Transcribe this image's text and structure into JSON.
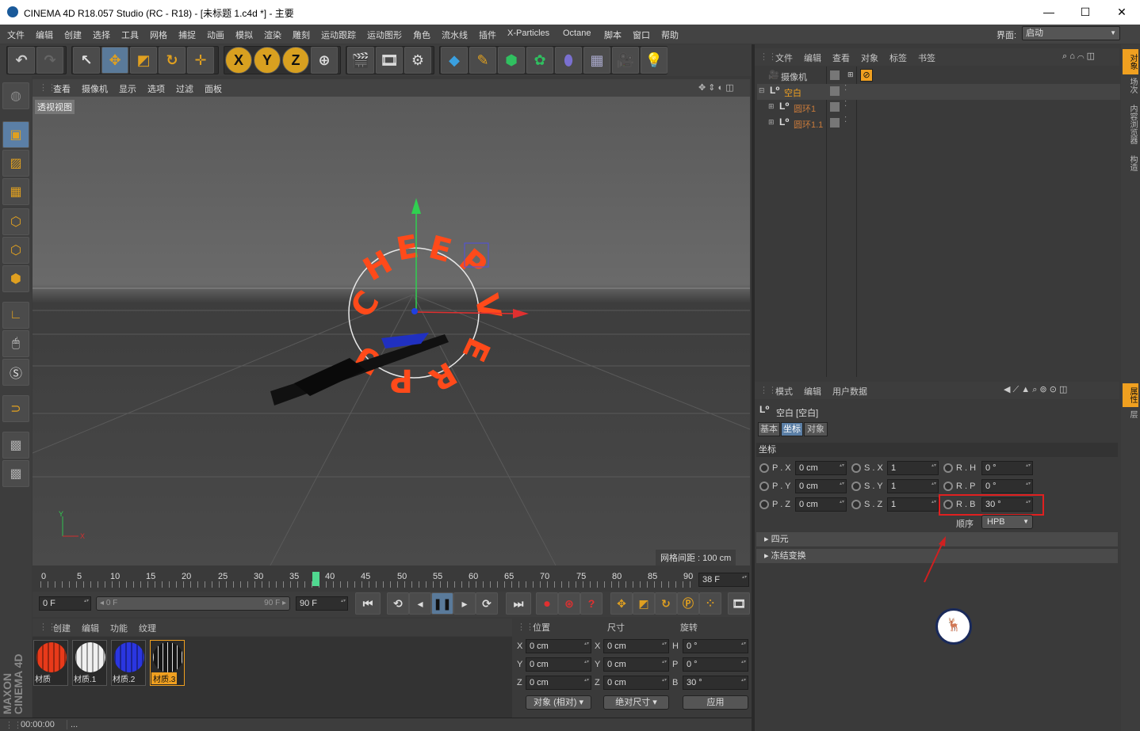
{
  "window": {
    "title": "CINEMA 4D R18.057 Studio (RC - R18) - [未标题 1.c4d *] - 主要",
    "min": "—",
    "max": "☐",
    "close": "✕"
  },
  "menu": {
    "items": [
      "文件",
      "编辑",
      "创建",
      "选择",
      "工具",
      "网格",
      "捕捉",
      "动画",
      "模拟",
      "渲染",
      "雕刻",
      "运动跟踪",
      "运动图形",
      "角色",
      "流水线",
      "插件",
      "X-Particles",
      "Octane",
      "脚本",
      "窗口",
      "帮助"
    ],
    "layout_label": "界面:",
    "layout_value": "启动"
  },
  "viewport": {
    "menu": [
      "查看",
      "摄像机",
      "显示",
      "选项",
      "过滤",
      "面板"
    ],
    "view_label": "透视视图",
    "grid_spacing": "网格间距 : 100 cm",
    "axis_x": "X",
    "axis_y": "Y"
  },
  "object_manager": {
    "menu": [
      "文件",
      "编辑",
      "查看",
      "对象",
      "标签",
      "书签"
    ],
    "objects": [
      {
        "name": "摄像机",
        "color": "#cccccc"
      },
      {
        "name": "空白",
        "color": "#f0a020"
      },
      {
        "name": "圆环1",
        "color": "#c87a3a"
      },
      {
        "name": "圆环1.1",
        "color": "#c87a3a"
      }
    ]
  },
  "right_tabs": [
    "对象",
    "场次",
    "内容浏览器",
    "构造"
  ],
  "right_tabs2": [
    "属性",
    "层"
  ],
  "attributes": {
    "menu": [
      "模式",
      "编辑",
      "用户数据"
    ],
    "object_title": "空白 [空白]",
    "tabs": [
      "基本",
      "坐标",
      "对象"
    ],
    "section": "坐标",
    "px_label": "P . X",
    "px": "0 cm",
    "py_label": "P . Y",
    "py": "0 cm",
    "pz_label": "P . Z",
    "pz": "0 cm",
    "sx_label": "S . X",
    "sx": "1",
    "sy_label": "S . Y",
    "sy": "1",
    "sz_label": "S . Z",
    "sz": "1",
    "rh_label": "R . H",
    "rh": "0 °",
    "rp_label": "R . P",
    "rp": "0 °",
    "rb_label": "R . B",
    "rb": "30 °",
    "order_label": "顺序",
    "order": "HPB",
    "quaternion": "四元",
    "freeze": "冻结变换"
  },
  "timeline": {
    "ticks": [
      "0",
      "5",
      "10",
      "15",
      "20",
      "25",
      "30",
      "35",
      "40",
      "45",
      "50",
      "55",
      "60",
      "65",
      "70",
      "75",
      "80",
      "85",
      "90"
    ],
    "current_frame": "38 F",
    "start": "0 F",
    "range_start": "0 F",
    "range_end": "90 F",
    "end": "90 F"
  },
  "materials": {
    "menu": [
      "创建",
      "编辑",
      "功能",
      "纹理"
    ],
    "items": [
      {
        "name": "材质",
        "color": "#e83a1a"
      },
      {
        "name": "材质.1",
        "color": "#f0f0f0"
      },
      {
        "name": "材质.2",
        "color": "#2a36e0"
      },
      {
        "name": "材质.3",
        "color": "#151515"
      }
    ]
  },
  "coordinates": {
    "headers": [
      "位置",
      "尺寸",
      "旋转"
    ],
    "pos_x": "0 cm",
    "pos_y": "0 cm",
    "pos_z": "0 cm",
    "size_x": "0 cm",
    "size_y": "0 cm",
    "size_z": "0 cm",
    "rot_h": "0 °",
    "rot_p": "0 °",
    "rot_b": "30 °",
    "mode": "对象 (相对)",
    "size_mode": "绝对尺寸",
    "apply": "应用",
    "lx": "X",
    "ly": "Y",
    "lz": "Z",
    "lsx": "X",
    "lsy": "Y",
    "lsz": "Z",
    "lh": "H",
    "lp": "P",
    "lb": "B"
  },
  "status": {
    "time": "00:00:00",
    "dots": "..."
  },
  "brand": "MAXON CINEMA 4D",
  "colors": {
    "accent": "#f0a020",
    "highlight_box": "#e02020",
    "text_red": "#ff4a1a"
  }
}
